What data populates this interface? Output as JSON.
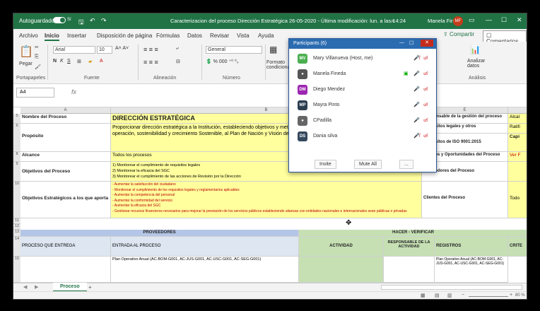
{
  "titlebar": {
    "autosave": "Autoguardado",
    "toggle_state": "Sí",
    "doc_title": "Caracterizacion del proceso Dirección Estratégica 26-05-2020 - Última modificación: lun. a las 14:24",
    "user_name": "Manela Fineda",
    "user_initials": "MF"
  },
  "ribbon_tabs": [
    "Archivo",
    "Inicio",
    "Insertar",
    "Disposición de página",
    "Fórmulas",
    "Datos",
    "Revisar",
    "Vista",
    "Ayuda"
  ],
  "ribbon_right": {
    "share": "Compartir",
    "comments": "Comentarios"
  },
  "ribbon": {
    "paste": "Pegar",
    "font_name": "Arial",
    "font_size": "10",
    "number_format": "General",
    "format_label": "Formato condicional",
    "analyze": "Analizar datos",
    "groups": [
      "Portapapeles",
      "Fuente",
      "Alineación",
      "Número",
      "Análisis"
    ]
  },
  "formula_bar": {
    "name_box": "A4",
    "fx": "fx"
  },
  "columns": [
    "A",
    "B",
    "E"
  ],
  "rows": {
    "r5": {
      "label": "Nombre del Proceso",
      "value": "DIRECCIÓN ESTRATÉGICA",
      "right": "Responsable de la gestión del proceso"
    },
    "r6": {
      "right": "Requisitos legales y otros"
    },
    "r6b": {
      "label": "Propósito",
      "value": "Proporcionar dirección estratégica a la Institución, estableciendo objetivos y metas, en el contexto de la Institución, para asegurar su eficaz operación, sostenibilidad y crecimiento Sostenible, al Plan de Nación y Visión de País, enmarcado en el Plan  Desarrollo",
      "right": "Requisitos de ISO 9001:2015"
    },
    "r8": {
      "label": "Alcance",
      "value": "Todos los procesos",
      "right": "Riesgos y Oportunidades del Proceso"
    },
    "r9": {
      "label": "Objetivos del Proceso",
      "lines": [
        "1) Monitorear el cumplimiento de requisitos legales",
        "2) Monitorear la eficacia del SGC",
        "3) Monitorear el cumplimiento de las acciones de Revisión por la Dirección"
      ],
      "right": "Proveedores del Proceso"
    },
    "r10": {
      "label": "Objetivos Estratégicos a los que aporta",
      "lines": [
        "- Aumentar la satisfacción del ciudadano",
        "- Monitorear el cumplimiento de los requisitos legales y reglamentarios aplicables",
        "- Aumentar la competencia del personal",
        "- Aumentar la conformidad del servicio",
        "- Aumentar la eficacia del SGC",
        "- Gestionar recursos financieros necesarios para mejorar la prestación de los servicios públicos estableciendo alianzas con entidades nacionales e internacionales sean públicas o privadas"
      ],
      "right": "Clientes del Proceso"
    },
    "r13": {
      "left": "PROVEEDORES",
      "right": "HACER  -  VERIFICAR"
    },
    "r14": {
      "c1": "PROCESO QUE ENTREGA",
      "c2": "ENTRADA AL PROCESO",
      "c3": "ACTIVIDAD",
      "c4": "RESPONSABLE DE LA ACTIVIDAD",
      "c5": "REGISTROS",
      "c6": "CRITE"
    },
    "r15": {
      "c2": "Plan Operativo Anual (AC-BOM-G001, AC-JUS-G001, AC-USC-G001, AC-SEG-G001)",
      "c5": "Plan Operativo Anual (AC-BOM-G001, AC-JUS-G001, AC-USC-G001, AC-SEG-G001)"
    }
  },
  "side_col": [
    "Alcal",
    "Ratifi",
    "Capi",
    "Ver F",
    "Todo"
  ],
  "row_numbers": [
    "5",
    "6",
    "7",
    "8",
    "9",
    "10",
    "11",
    "12",
    "13",
    "14",
    "15"
  ],
  "sheet": {
    "tab": "Proceso",
    "add": "+"
  },
  "status": {
    "zoom": "80 %"
  },
  "participants": {
    "title": "Participants (6)",
    "people": [
      {
        "initials": "MV",
        "name": "Mary Villanueva (Host, me)",
        "color": "#4caf50"
      },
      {
        "initials": "",
        "name": "Manela Fineda",
        "color": "#555555"
      },
      {
        "initials": "DM",
        "name": "Diego Mendez",
        "color": "#9c27b0"
      },
      {
        "initials": "MP",
        "name": "Mayra Pinto",
        "color": "#2c3e50"
      },
      {
        "initials": "",
        "name": "CPadilla",
        "color": "#666666"
      },
      {
        "initials": "DS",
        "name": "Dania silva",
        "color": "#34495e"
      }
    ],
    "buttons": [
      "Invite",
      "Mute All",
      "..."
    ]
  }
}
